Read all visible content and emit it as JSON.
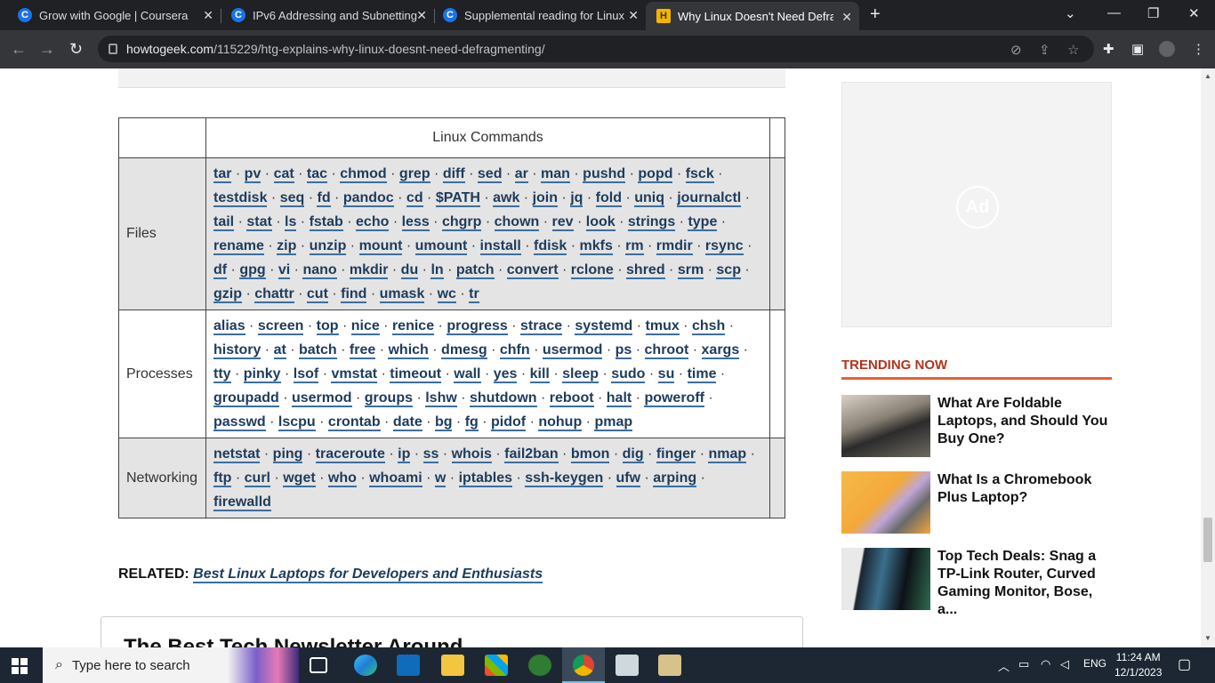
{
  "browser": {
    "tabs": [
      {
        "title": "Grow with Google | Coursera",
        "favicon": "C"
      },
      {
        "title": "IPv6 Addressing and Subnetting",
        "favicon": "C"
      },
      {
        "title": "Supplemental reading for Linux",
        "favicon": "C"
      },
      {
        "title": "Why Linux Doesn't Need Defrag",
        "favicon": "H"
      }
    ],
    "url_domain": "howtogeek.com",
    "url_path": "/115229/htg-explains-why-linux-doesnt-need-defragmenting/"
  },
  "table": {
    "header": "Linux Commands",
    "rows": [
      {
        "category": "Files",
        "commands": [
          "tar",
          "pv",
          "cat",
          "tac",
          "chmod",
          "grep",
          "diff",
          "sed",
          "ar",
          "man",
          "pushd",
          "popd",
          "fsck",
          "testdisk",
          "seq",
          "fd",
          "pandoc",
          "cd",
          "$PATH",
          "awk",
          "join",
          "jq",
          "fold",
          "uniq",
          "journalctl",
          "tail",
          "stat",
          "ls",
          "fstab",
          "echo",
          "less",
          "chgrp",
          "chown",
          "rev",
          "look",
          "strings",
          "type",
          "rename",
          "zip",
          "unzip",
          "mount",
          "umount",
          "install",
          "fdisk",
          "mkfs",
          "rm",
          "rmdir",
          "rsync",
          "df",
          "gpg",
          "vi",
          "nano",
          "mkdir",
          "du",
          "ln",
          "patch",
          "convert",
          "rclone",
          "shred",
          "srm",
          "scp",
          "gzip",
          "chattr",
          "cut",
          "find",
          "umask",
          "wc",
          "tr"
        ]
      },
      {
        "category": "Processes",
        "commands": [
          "alias",
          "screen",
          "top",
          "nice",
          "renice",
          "progress",
          "strace",
          "systemd",
          "tmux",
          "chsh",
          "history",
          "at",
          "batch",
          "free",
          "which",
          "dmesg",
          "chfn",
          "usermod",
          "ps",
          "chroot",
          "xargs",
          "tty",
          "pinky",
          "lsof",
          "vmstat",
          "timeout",
          "wall",
          "yes",
          "kill",
          "sleep",
          "sudo",
          "su",
          "time",
          "groupadd",
          "usermod",
          "groups",
          "lshw",
          "shutdown",
          "reboot",
          "halt",
          "poweroff",
          "passwd",
          "lscpu",
          "crontab",
          "date",
          "bg",
          "fg",
          "pidof",
          "nohup",
          "pmap"
        ]
      },
      {
        "category": "Networking",
        "commands": [
          "netstat",
          "ping",
          "traceroute",
          "ip",
          "ss",
          "whois",
          "fail2ban",
          "bmon",
          "dig",
          "finger",
          "nmap",
          "ftp",
          "curl",
          "wget",
          "who",
          "whoami",
          "w",
          "iptables",
          "ssh-keygen",
          "ufw",
          "arping",
          "firewalld"
        ]
      }
    ]
  },
  "related": {
    "label": "RELATED:",
    "link": "Best Linux Laptops for Developers and Enthusiasts"
  },
  "newsletter": {
    "title": "The Best Tech Newsletter Around"
  },
  "sidebar": {
    "ad_label": "Ad",
    "trending_title": "TRENDING NOW",
    "trending": [
      "What Are Foldable Laptops, and Should You Buy One?",
      "What Is a Chromebook Plus Laptop?",
      "Top Tech Deals: Snag a TP-Link Router, Curved Gaming Monitor, Bose, a..."
    ]
  },
  "taskbar": {
    "search_placeholder": "Type here to search",
    "language": "ENG",
    "time": "11:24 AM",
    "date": "12/1/2023"
  }
}
